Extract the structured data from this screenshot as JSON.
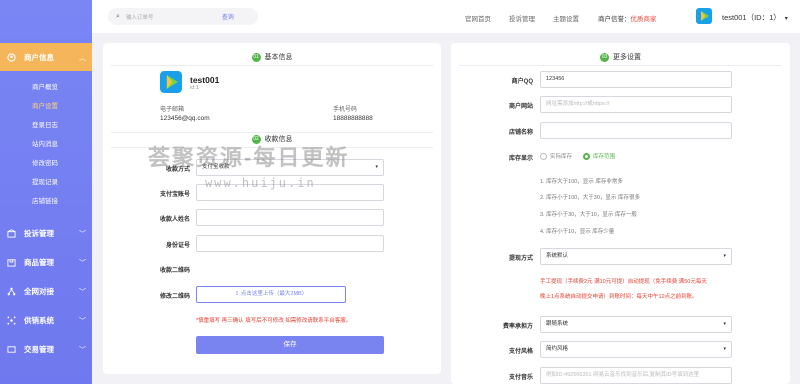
{
  "sidebar": {
    "groups": [
      {
        "label": "商户信息",
        "icon": "store-icon"
      },
      {
        "label": "投诉管理",
        "icon": "complaint-icon"
      },
      {
        "label": "商品管理",
        "icon": "goods-icon"
      },
      {
        "label": "全网对接",
        "icon": "network-icon"
      },
      {
        "label": "供销系统",
        "icon": "supply-icon"
      },
      {
        "label": "交易管理",
        "icon": "trade-icon"
      }
    ],
    "sub_items": [
      "商户概览",
      "商户设置",
      "登录日志",
      "站内消息",
      "修改密码",
      "提现记录",
      "店铺链接"
    ],
    "active_sub": "商户设置"
  },
  "topbar": {
    "search_placeholder": "输入订单号",
    "search_button": "查询",
    "nav": [
      "官网首页",
      "投诉管理",
      "主题设置"
    ],
    "rating_label": "商户信誉：",
    "rating_value": "优质商家",
    "user_label": "test001（ID：1）"
  },
  "left": {
    "basic_num": "01",
    "basic_title": "基本信息",
    "name": "test001",
    "id": "id:1",
    "email_label": "电子邮箱",
    "email": "123456@qq.com",
    "phone_label": "手机号码",
    "phone": "18888888888",
    "pay_num": "02",
    "pay_title": "收款信息",
    "fields": {
      "method_label": "收款方式",
      "method_value": "支付宝收款",
      "account_label": "支付宝账号",
      "name_label": "收款人姓名",
      "idcard_label": "身份证号",
      "qr_label": "收款二维码",
      "qr_edit_label": "修改二维码",
      "upload_text": "点击这里上传（最大2MB）"
    },
    "warning": "*慎重填写 再三确认 填写后不可修改 如需修改请联系平台客服。",
    "save": "保存"
  },
  "right": {
    "num": "03",
    "title": "更多设置",
    "qq_label": "商户QQ",
    "qq_value": "123456",
    "site_label": "商户网站",
    "site_placeholder": "网址需添加http://或https://",
    "shop_label": "店铺名称",
    "stock_label": "库存显示",
    "stock_opt1": "实际库存",
    "stock_opt2": "库存范围",
    "hints": [
      "1. 库存大于100，显示 库存非常多",
      "2. 库存小于100，大于30，显示 库存很多",
      "3. 库存小于30，大于10，显示 库存一般",
      "4. 库存小于10，显示 库存少量"
    ],
    "withdraw_label": "提现方式",
    "withdraw_value": "系统默认",
    "withdraw_warn_1": "手工提现（手续费2元 满10元可提）自动提现（免手续费 满50元每天",
    "withdraw_warn_2": "晚上1点系统自动提交申请）到账时间：每天中午12点之前到账。",
    "fee_label": "费率承担方",
    "fee_value": "跟随系统",
    "style_label": "支付风格",
    "style_value": "简约风格",
    "music_label": "支付音乐",
    "music_placeholder": "例如ID:492566351 网易云音乐找到音乐后,复制其ID号填到这里"
  },
  "watermark": {
    "line1": "荟聚资源-每日更新",
    "line2": "www.huiju.in"
  },
  "colors": {
    "sidebar": "#7a86f4",
    "accent": "#7a84f0",
    "active": "#f5b55a",
    "success": "#52b448",
    "danger": "#e63c2f"
  }
}
